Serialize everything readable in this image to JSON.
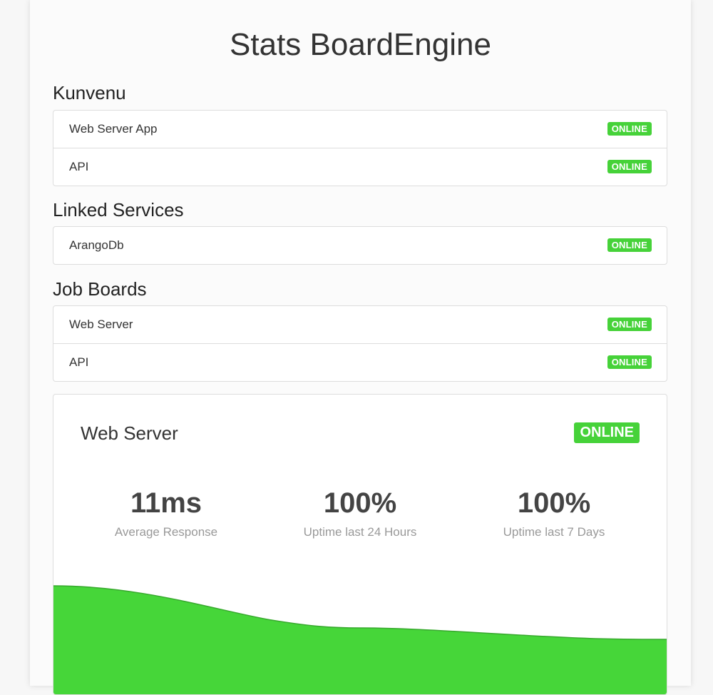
{
  "page": {
    "title": "Stats BoardEngine"
  },
  "sections": [
    {
      "heading": "Kunvenu",
      "items": [
        {
          "label": "Web Server App",
          "status": "ONLINE"
        },
        {
          "label": "API",
          "status": "ONLINE"
        }
      ]
    },
    {
      "heading": "Linked Services",
      "items": [
        {
          "label": "ArangoDb",
          "status": "ONLINE"
        }
      ]
    },
    {
      "heading": "Job Boards",
      "items": [
        {
          "label": "Web Server",
          "status": "ONLINE"
        },
        {
          "label": "API",
          "status": "ONLINE"
        }
      ]
    }
  ],
  "detail": {
    "title": "Web Server",
    "status": "ONLINE",
    "stats": [
      {
        "value": "11ms",
        "label": "Average Response"
      },
      {
        "value": "100%",
        "label": "Uptime last 24 Hours"
      },
      {
        "value": "100%",
        "label": "Uptime last 7 Days"
      }
    ]
  },
  "colors": {
    "online": "#46d239",
    "chart_fill": "#46d639",
    "chart_line": "#36a82c"
  }
}
